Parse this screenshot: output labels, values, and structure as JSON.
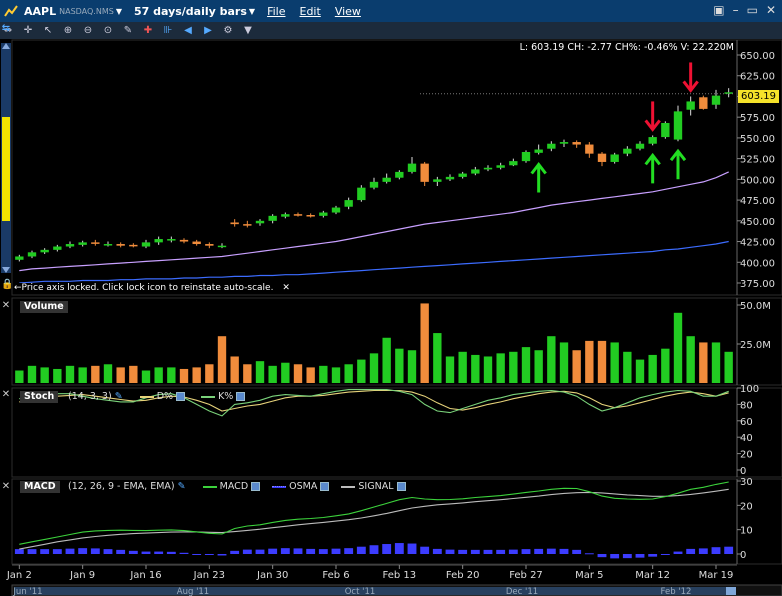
{
  "window": {
    "symbol": "AAPL",
    "exchange": "NASDAQ.NMS",
    "period": "57 days/daily bars",
    "menus": [
      "File",
      "Edit",
      "View"
    ]
  },
  "price_panel": {
    "info": "L: 603.19 CH: -2.77 CH%: -0.46% V: 22.220M",
    "last_price": "603.19",
    "lock_note": "Price axis locked.  Click lock icon to reinstate auto-scale.",
    "axis_ticks": [
      "650.00",
      "625.00",
      "600.00",
      "575.00",
      "550.00",
      "525.00",
      "500.00",
      "475.00",
      "450.00",
      "425.00",
      "400.00",
      "375.00"
    ]
  },
  "volume_panel": {
    "title": "Volume",
    "axis_ticks": [
      "50.0M",
      "25.0M"
    ]
  },
  "stoch_panel": {
    "title": "Stoch",
    "params": "(14, 3, 3)",
    "d_label": "D%",
    "k_label": "K%",
    "axis_ticks": [
      "100",
      "80",
      "60",
      "40",
      "20",
      "0"
    ]
  },
  "macd_panel": {
    "title": "MACD",
    "params": "(12, 26, 9 - EMA, EMA)",
    "macd_label": "MACD",
    "osma_label": "OSMA",
    "signal_label": "SIGNAL",
    "axis_ticks": [
      "30",
      "20",
      "10",
      "0"
    ]
  },
  "x_axis": {
    "date_labels": [
      "Jan 2",
      "Jan 9",
      "Jan 16",
      "Jan 23",
      "Jan 30",
      "Feb 6",
      "Feb 13",
      "Feb 20",
      "Feb 27",
      "Mar 5",
      "Mar 12",
      "Mar 19"
    ],
    "scroll_labels": [
      "Jun '11",
      "Aug '11",
      "Oct '11",
      "Dec '11",
      "Feb '12"
    ]
  },
  "colors": {
    "up": "#22cc22",
    "down": "#f08c3c",
    "ma_purple": "#c8a0ff",
    "ma_blue": "#3c6cff",
    "stoch_d": "#e6d27a",
    "stoch_k": "#7ad27a",
    "macd": "#3cd23c",
    "signal": "#bbbbbb",
    "osma": "#3c3cff",
    "arrow_up": "#22dd22",
    "arrow_down": "#ee1133"
  },
  "chart_data": [
    {
      "type": "candlestick",
      "title": "AAPL NASDAQ.NMS",
      "ylim": [
        375,
        650
      ],
      "dates": [
        "Jan 2",
        "Jan 3",
        "Jan 4",
        "Jan 5",
        "Jan 6",
        "Jan 9",
        "Jan 10",
        "Jan 11",
        "Jan 12",
        "Jan 13",
        "Jan 16",
        "Jan 17",
        "Jan 18",
        "Jan 19",
        "Jan 20",
        "Jan 23",
        "Jan 24",
        "Jan 25",
        "Jan 26",
        "Jan 27",
        "Jan 30",
        "Jan 31",
        "Feb 1",
        "Feb 2",
        "Feb 3",
        "Feb 6",
        "Feb 7",
        "Feb 8",
        "Feb 9",
        "Feb 10",
        "Feb 13",
        "Feb 14",
        "Feb 15",
        "Feb 16",
        "Feb 17",
        "Feb 20",
        "Feb 21",
        "Feb 22",
        "Feb 23",
        "Feb 24",
        "Feb 27",
        "Feb 28",
        "Feb 29",
        "Mar 1",
        "Mar 2",
        "Mar 5",
        "Mar 6",
        "Mar 7",
        "Mar 8",
        "Mar 9",
        "Mar 12",
        "Mar 13",
        "Mar 14",
        "Mar 15",
        "Mar 16",
        "Mar 19",
        "Mar 20"
      ],
      "open": [
        403,
        407,
        412,
        415,
        419,
        421,
        424,
        421,
        422,
        421,
        419,
        424,
        427,
        427,
        425,
        422,
        420,
        448,
        446,
        447,
        450,
        455,
        458,
        457,
        456,
        460,
        467,
        475,
        490,
        497,
        502,
        509,
        519,
        497,
        500,
        503,
        507,
        512,
        514,
        517,
        522,
        532,
        537,
        543,
        545,
        542,
        531,
        521,
        531,
        537,
        543,
        551,
        548,
        584,
        599,
        590,
        604
      ],
      "close": [
        407,
        412,
        415,
        419,
        422,
        424,
        423,
        422,
        420,
        420,
        424,
        428,
        428,
        425,
        422,
        420,
        420,
        446,
        445,
        450,
        456,
        458,
        457,
        456,
        460,
        466,
        475,
        490,
        497,
        502,
        509,
        519,
        497,
        500,
        503,
        507,
        512,
        514,
        517,
        522,
        533,
        536,
        543,
        545,
        542,
        531,
        521,
        530,
        537,
        543,
        551,
        568,
        582,
        594,
        585,
        601,
        605
      ],
      "high": [
        409,
        414,
        417,
        421,
        425,
        426,
        427,
        425,
        424,
        423,
        427,
        431,
        431,
        429,
        427,
        424,
        423,
        452,
        450,
        452,
        458,
        460,
        460,
        459,
        462,
        468,
        478,
        493,
        502,
        507,
        511,
        527,
        521,
        503,
        506,
        509,
        515,
        517,
        520,
        525,
        535,
        542,
        546,
        548,
        547,
        545,
        533,
        532,
        540,
        546,
        553,
        570,
        589,
        600,
        601,
        608,
        610
      ],
      "low": [
        401,
        405,
        410,
        413,
        417,
        419,
        420,
        419,
        418,
        418,
        417,
        421,
        424,
        423,
        420,
        417,
        417,
        443,
        442,
        444,
        447,
        453,
        455,
        454,
        454,
        458,
        464,
        473,
        488,
        495,
        500,
        507,
        492,
        492,
        498,
        501,
        505,
        510,
        512,
        516,
        520,
        530,
        534,
        539,
        538,
        526,
        516,
        519,
        528,
        535,
        541,
        549,
        546,
        577,
        584,
        585,
        599
      ],
      "ma_purple": [
        390,
        392,
        393,
        394,
        395,
        396,
        397,
        398,
        399,
        400,
        401,
        402,
        403,
        404,
        405,
        406,
        407,
        409,
        411,
        413,
        415,
        417,
        419,
        421,
        423,
        425,
        428,
        431,
        434,
        437,
        440,
        443,
        446,
        448,
        450,
        452,
        454,
        456,
        458,
        460,
        463,
        466,
        469,
        471,
        473,
        475,
        477,
        479,
        481,
        483,
        485,
        488,
        491,
        494,
        497,
        502,
        509
      ],
      "ma_blue": [
        375,
        376,
        377,
        377,
        377,
        378,
        378,
        378,
        379,
        379,
        380,
        380,
        380,
        381,
        381,
        382,
        382,
        383,
        383,
        384,
        384,
        385,
        385,
        386,
        387,
        388,
        389,
        390,
        391,
        392,
        393,
        394,
        395,
        396,
        397,
        398,
        399,
        400,
        401,
        402,
        403,
        404,
        405,
        406,
        407,
        408,
        409,
        410,
        411,
        412,
        413,
        415,
        416,
        418,
        420,
        422,
        425
      ],
      "arrows_up": [
        "Feb 28",
        "Mar 12",
        "Mar 14"
      ],
      "arrows_down": [
        "Mar 12",
        "Mar 15"
      ]
    },
    {
      "type": "bar",
      "title": "Volume",
      "ylim": [
        0,
        50
      ],
      "values": [
        8,
        11,
        10,
        9,
        11,
        10,
        11,
        12,
        10,
        11,
        8,
        10,
        10,
        9,
        10,
        12,
        30,
        17,
        12,
        14,
        11,
        13,
        12,
        10,
        11,
        10,
        12,
        15,
        19,
        29,
        22,
        21,
        51,
        32,
        17,
        20,
        18,
        17,
        19,
        20,
        23,
        21,
        30,
        26,
        21,
        27,
        27,
        26,
        20,
        15,
        18,
        22,
        45,
        30,
        26,
        26,
        20
      ],
      "colors_up": [
        true,
        true,
        true,
        true,
        true,
        true,
        false,
        true,
        false,
        false,
        true,
        true,
        true,
        false,
        false,
        false,
        false,
        false,
        false,
        true,
        true,
        true,
        false,
        false,
        true,
        true,
        true,
        true,
        true,
        true,
        true,
        true,
        false,
        true,
        true,
        true,
        true,
        true,
        true,
        true,
        true,
        true,
        true,
        true,
        false,
        false,
        false,
        true,
        true,
        true,
        true,
        true,
        true,
        true,
        false,
        true,
        true
      ]
    },
    {
      "type": "line",
      "title": "Stoch",
      "ylim": [
        0,
        100
      ],
      "series": [
        {
          "name": "D%",
          "values": [
            83,
            86,
            88,
            90,
            91,
            92,
            90,
            88,
            86,
            84,
            85,
            88,
            90,
            89,
            85,
            80,
            72,
            75,
            78,
            80,
            84,
            88,
            90,
            90,
            91,
            93,
            95,
            96,
            97,
            97,
            97,
            95,
            90,
            82,
            75,
            73,
            76,
            80,
            83,
            87,
            90,
            93,
            95,
            96,
            94,
            88,
            80,
            76,
            78,
            82,
            86,
            90,
            93,
            95,
            93,
            90,
            94
          ]
        },
        {
          "name": "K%",
          "values": [
            87,
            90,
            91,
            93,
            93,
            90,
            87,
            85,
            83,
            83,
            88,
            92,
            93,
            88,
            80,
            72,
            66,
            80,
            82,
            85,
            90,
            92,
            91,
            90,
            93,
            96,
            98,
            98,
            98,
            98,
            96,
            92,
            80,
            72,
            70,
            75,
            80,
            85,
            88,
            92,
            94,
            96,
            97,
            95,
            90,
            80,
            72,
            76,
            82,
            88,
            92,
            95,
            97,
            96,
            90,
            90,
            96
          ]
        }
      ]
    },
    {
      "type": "line",
      "title": "MACD",
      "ylim": [
        0,
        30
      ],
      "series": [
        {
          "name": "MACD",
          "values": [
            4,
            5,
            6,
            7,
            8,
            9,
            9.5,
            9.7,
            9.8,
            9.7,
            9.6,
            9.8,
            9.9,
            9.6,
            9.1,
            8.5,
            8.2,
            10.5,
            11.5,
            12,
            13,
            13.8,
            14.3,
            14.6,
            15,
            15.7,
            16.5,
            17.8,
            19.3,
            20.8,
            22.3,
            23.2,
            22.6,
            22.3,
            22.4,
            22.7,
            23.2,
            23.6,
            24,
            24.6,
            25.3,
            25.9,
            26.6,
            27,
            26.9,
            25.6,
            23.8,
            22.9,
            22.6,
            22.5,
            22.6,
            23.6,
            25,
            26.6,
            27.4,
            28.6,
            29.6
          ]
        },
        {
          "name": "SIGNAL",
          "values": [
            2,
            3,
            4,
            5,
            5.8,
            6.6,
            7.2,
            7.7,
            8.1,
            8.4,
            8.6,
            8.8,
            9,
            9.1,
            9.1,
            8.9,
            8.8,
            9.2,
            9.7,
            10.2,
            10.8,
            11.4,
            12,
            12.5,
            13,
            13.5,
            14.1,
            14.8,
            15.7,
            16.7,
            17.8,
            18.9,
            19.6,
            20.2,
            20.6,
            21,
            21.5,
            21.9,
            22.3,
            22.8,
            23.3,
            23.8,
            24.4,
            24.9,
            25.2,
            25.3,
            25.1,
            24.7,
            24.3,
            24,
            23.7,
            23.7,
            24,
            24.5,
            25.1,
            25.8,
            26.6
          ]
        },
        {
          "name": "OSMA",
          "values": [
            2,
            2,
            2,
            2,
            2.2,
            2.4,
            2.3,
            2,
            1.7,
            1.3,
            1,
            1,
            0.9,
            0.5,
            0,
            -0.4,
            -0.6,
            1.3,
            1.8,
            1.8,
            2.2,
            2.4,
            2.3,
            2.1,
            2,
            2.2,
            2.4,
            3,
            3.6,
            4.1,
            4.5,
            4.3,
            3,
            2.1,
            1.8,
            1.7,
            1.7,
            1.7,
            1.7,
            1.8,
            2,
            2.1,
            2.2,
            2.1,
            1.7,
            0.3,
            -1.3,
            -1.8,
            -1.7,
            -1.5,
            -1.1,
            -0.1,
            1,
            2.1,
            2.3,
            2.8,
            3
          ]
        }
      ]
    }
  ]
}
